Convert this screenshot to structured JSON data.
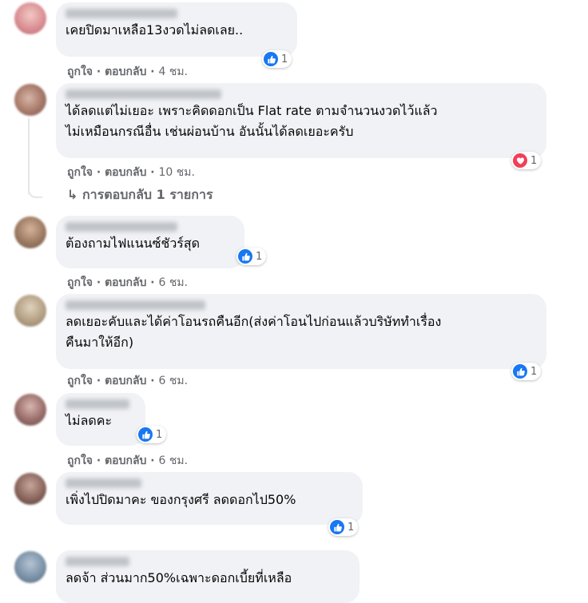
{
  "actions": {
    "like": "ถูกใจ",
    "reply": "ตอบกลับ",
    "separator": "·"
  },
  "colors": {
    "bubble": "#f0f2f5",
    "like": "#1877f2",
    "love": "#f33e58",
    "meta": "#65676b"
  },
  "comments": [
    {
      "name": "",
      "text_lines": [
        "เคยปิดมาเหลือ13งวดไม่ลดเลย.."
      ],
      "time": "4 ชม.",
      "reaction": {
        "type": "like-icon",
        "count": "1"
      }
    },
    {
      "name": "",
      "text_lines": [
        "ได้ลดแต่ไม่เยอะ เพราะคิดดอกเป็น Flat rate ตามจำนวนงวดไว้แล้ว",
        "ไม่เหมือนกรณีอื่น เช่นผ่อนบ้าน อันนั้นได้ลดเยอะครับ"
      ],
      "time": "10 ชม.",
      "reaction": {
        "type": "love-icon",
        "count": "1"
      }
    },
    {
      "name": "",
      "text_lines": [
        "ต้องถามไฟแนนซ์ชัวร์สุด"
      ],
      "time": "6 ชม.",
      "reaction": {
        "type": "like-icon",
        "count": "1"
      }
    },
    {
      "name": "",
      "text_lines": [
        "ลดเยอะคับและได้ค่าโอนรถคืนอีก(ส่งค่าโอนไปก่อนแล้วบริษัททำเรื่อง",
        "คืนมาให้อีก)"
      ],
      "time": "6 ชม.",
      "reaction": {
        "type": "like-icon",
        "count": "1"
      }
    },
    {
      "name": "",
      "text_lines": [
        "ไม่ลดคะ"
      ],
      "time": "6 ชม.",
      "reaction": {
        "type": "like-icon",
        "count": "1"
      }
    },
    {
      "name": "",
      "text_lines": [
        "เพิ่งไปปิดมาคะ ของกรุงศรี ลดดอกไป50%"
      ],
      "time": "6 ชม.",
      "reaction": {
        "type": "like-icon",
        "count": "1"
      }
    },
    {
      "name": "",
      "text_lines": [
        "ลดจ้า ส่วนมาก50%เฉพาะดอกเบี้ยที่เหลือ"
      ],
      "time": "",
      "reaction": null
    }
  ],
  "replies_link": "↳ การตอบกลับ 1 รายการ"
}
